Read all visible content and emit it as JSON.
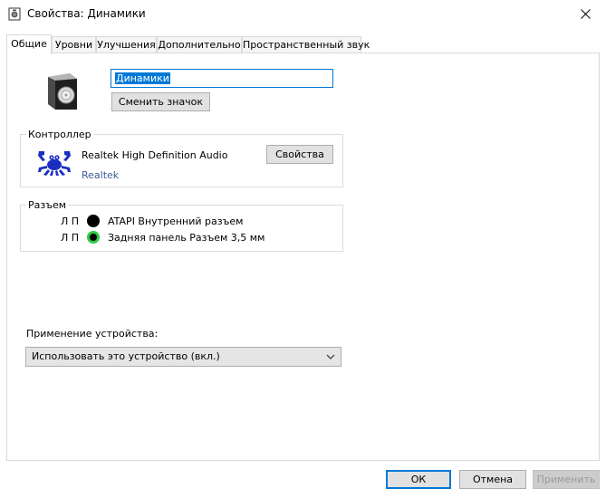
{
  "window": {
    "title": "Свойства: Динамики"
  },
  "tabs": [
    {
      "label": "Общие",
      "active": true
    },
    {
      "label": "Уровни",
      "active": false
    },
    {
      "label": "Улучшения",
      "active": false
    },
    {
      "label": "Дополнительно",
      "active": false
    },
    {
      "label": "Пространственный звук",
      "active": false
    }
  ],
  "device": {
    "name_value": "Динамики",
    "change_icon_label": "Сменить значок"
  },
  "controller": {
    "group_title": "Контроллер",
    "name": "Realtek High Definition Audio",
    "vendor_link": "Realtek",
    "properties_label": "Свойства"
  },
  "jacks": {
    "group_title": "Разъем",
    "items": [
      {
        "channels": "Л П",
        "label": "ATAPI Внутренний разъем",
        "color": "#000000"
      },
      {
        "channels": "Л П",
        "label": "Задняя панель Разъем 3,5 мм",
        "color": "#2ecc40"
      }
    ]
  },
  "usage": {
    "label": "Применение устройства:",
    "selected": "Использовать это устройство (вкл.)"
  },
  "footer": {
    "ok_label": "ОК",
    "cancel_label": "Отмена",
    "apply_label": "Применить"
  },
  "colors": {
    "accent": "#0078d7",
    "link": "#3b5a9a"
  }
}
